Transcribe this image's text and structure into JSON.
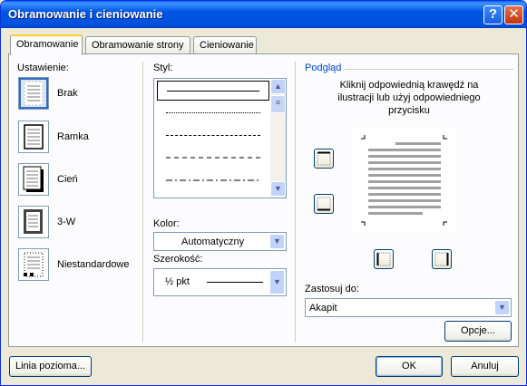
{
  "window": {
    "title": "Obramowanie i cieniowanie"
  },
  "tabs": [
    {
      "label": "Obramowanie"
    },
    {
      "label": "Obramowanie strony"
    },
    {
      "label": "Cieniowanie"
    }
  ],
  "setting": {
    "header": "Ustawienie:",
    "items": [
      {
        "label": "Brak",
        "icon": "border-none-icon"
      },
      {
        "label": "Ramka",
        "icon": "border-box-icon"
      },
      {
        "label": "Cień",
        "icon": "border-shadow-icon"
      },
      {
        "label": "3-W",
        "icon": "border-3d-icon"
      },
      {
        "label": "Niestandardowe",
        "icon": "border-custom-icon"
      }
    ]
  },
  "style": {
    "header": "Styl:"
  },
  "color": {
    "header": "Kolor:",
    "value": "Automatyczny"
  },
  "width": {
    "header": "Szerokość:",
    "value": "½ pkt"
  },
  "preview": {
    "header": "Podgląd",
    "hint": "Kliknij odpowiednią krawędź na ilustracji lub użyj odpowiedniego przycisku"
  },
  "apply_to": {
    "header": "Zastosuj do:",
    "value": "Akapit"
  },
  "buttons": {
    "options": "Opcje...",
    "horizontal_line": "Linia pozioma...",
    "ok": "OK",
    "cancel": "Anuluj"
  }
}
